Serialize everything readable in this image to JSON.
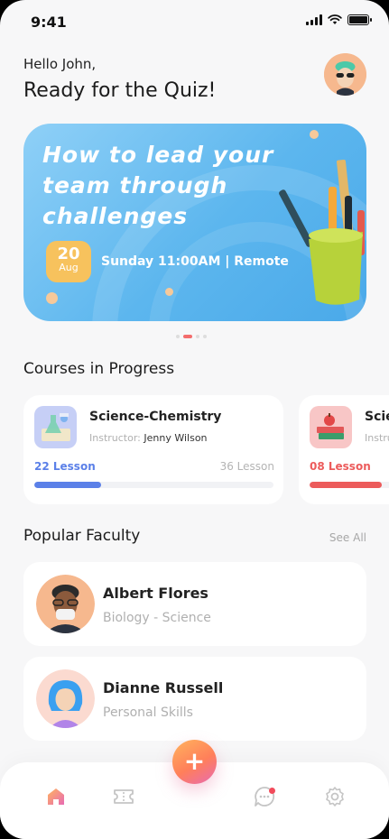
{
  "status_bar": {
    "time": "9:41"
  },
  "header": {
    "greeting": "Hello John,",
    "headline": "Ready for the Quiz!"
  },
  "banner": {
    "title": "How to lead your team through challenges",
    "date_day": "20",
    "date_month": "Aug",
    "schedule": "Sunday 11:00AM | Remote",
    "pager_count": 4,
    "pager_active_index": 1
  },
  "courses": {
    "section_title": "Courses in Progress",
    "items": [
      {
        "name": "Science-Chemistry",
        "instructor_label": "Instructor:",
        "instructor": "Jenny Wilson",
        "lessons_done": "22 Lesson",
        "lessons_total": "36 Lesson",
        "progress": 0.28,
        "color": "#5b80e8",
        "icon": "chemistry-flask-icon"
      },
      {
        "name": "Science",
        "instructor_label": "Instructor:",
        "instructor": "",
        "lessons_done": "08 Lesson",
        "lessons_total": "",
        "progress": 0.3,
        "color": "#ec5b5b",
        "icon": "books-apple-icon"
      }
    ]
  },
  "faculty": {
    "section_title": "Popular Faculty",
    "see_all": "See All",
    "items": [
      {
        "name": "Albert Flores",
        "role": "Biology - Science"
      },
      {
        "name": "Dianne Russell",
        "role": "Personal Skills"
      }
    ]
  },
  "nav": {
    "items": [
      "home-icon",
      "ticket-icon",
      "add-icon",
      "chat-icon",
      "settings-icon"
    ],
    "fab_label": "+",
    "active": "home-icon"
  },
  "colors": {
    "accent_orange": "#ff8c4a",
    "banner_blue": "#5cb6ee",
    "date_badge": "#f7c25d"
  }
}
